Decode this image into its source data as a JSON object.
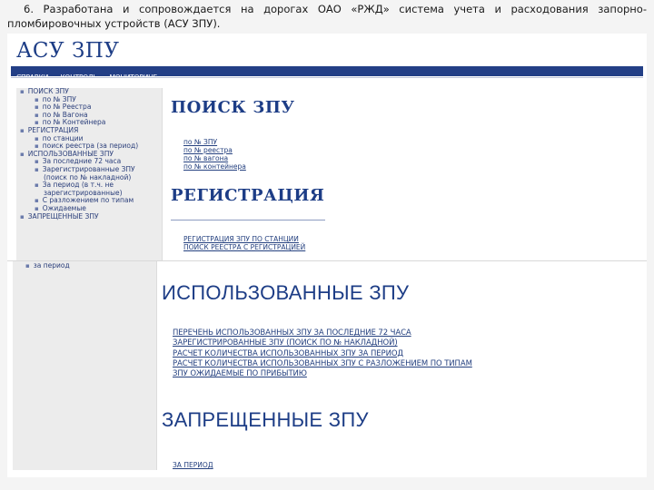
{
  "caption": "6. Разработана и сопровождается на дорогах ОАО «РЖД» система учета и расходования запорно-пломбировочных устройств (АСУ ЗПУ).",
  "app": {
    "title": "АСУ ЗПУ",
    "menu": [
      "СПРАВКИ",
      "КОНТРОЛЬ",
      "МОНИТОРИНГ"
    ]
  },
  "nav": [
    {
      "level": 0,
      "label": "ПОИСК ЗПУ"
    },
    {
      "level": 1,
      "label": "по № ЗПУ"
    },
    {
      "level": 1,
      "label": "по № Реестра"
    },
    {
      "level": 1,
      "label": "по № Вагона"
    },
    {
      "level": 1,
      "label": "по № Контейнера"
    },
    {
      "level": 0,
      "label": "РЕГИСТРАЦИЯ"
    },
    {
      "level": 1,
      "label": "по станции"
    },
    {
      "level": 1,
      "label": "поиск реестра (за период)"
    },
    {
      "level": 0,
      "label": "ИСПОЛЬЗОВАННЫЕ ЗПУ"
    },
    {
      "level": 1,
      "label": "За последние 72 часа"
    },
    {
      "level": 1,
      "label": "Зарегистрированные ЗПУ"
    },
    {
      "level": 2,
      "label": "(поиск по № накладной)"
    },
    {
      "level": 1,
      "label": "За период (в т.ч. не"
    },
    {
      "level": 2,
      "label": "зарегистрированные)"
    },
    {
      "level": 1,
      "label": "С разложением по типам"
    },
    {
      "level": 1,
      "label": "Ожидаемые"
    },
    {
      "level": 0,
      "label": "ЗАПРЕЩЕННЫЕ ЗПУ"
    }
  ],
  "nav2": [
    "за период"
  ],
  "search": {
    "heading": "ПОИСК ЗПУ",
    "links": [
      "по № ЗПУ",
      "по № реестра",
      "по № вагона",
      "по № контейнера"
    ]
  },
  "registration": {
    "heading": "РЕГИСТРАЦИЯ",
    "links": [
      "РЕГИСТРАЦИЯ ЗПУ ПО СТАНЦИИ",
      "ПОИСК РЕЕСТРА С РЕГИСТРАЦИЕЙ"
    ]
  },
  "used": {
    "heading": "ИСПОЛЬЗОВАННЫЕ ЗПУ",
    "links": [
      "ПЕРЕЧЕНЬ ИСПОЛЬЗОВАННЫХ ЗПУ ЗА ПОСЛЕДНИЕ 72 ЧАСА",
      "ЗАРЕГИСТРИРОВАННЫЕ ЗПУ (ПОИСК ПО № НАКЛАДНОЙ)",
      "РАСЧЕТ КОЛИЧЕСТВА ИСПОЛЬЗОВАННЫХ ЗПУ ЗА ПЕРИОД",
      "РАСЧЕТ КОЛИЧЕСТВА ИСПОЛЬЗОВАННЫХ ЗПУ С РАЗЛОЖЕНИЕМ ПО ТИПАМ",
      "ЗПУ ОЖИДАЕМЫЕ ПО ПРИБЫТИЮ"
    ]
  },
  "prohibited": {
    "heading": "ЗАПРЕЩЕННЫЕ ЗПУ",
    "link": "ЗА ПЕРИОД"
  },
  "colors": {
    "brand": "#1d3d86",
    "menubar": "#233f86"
  }
}
